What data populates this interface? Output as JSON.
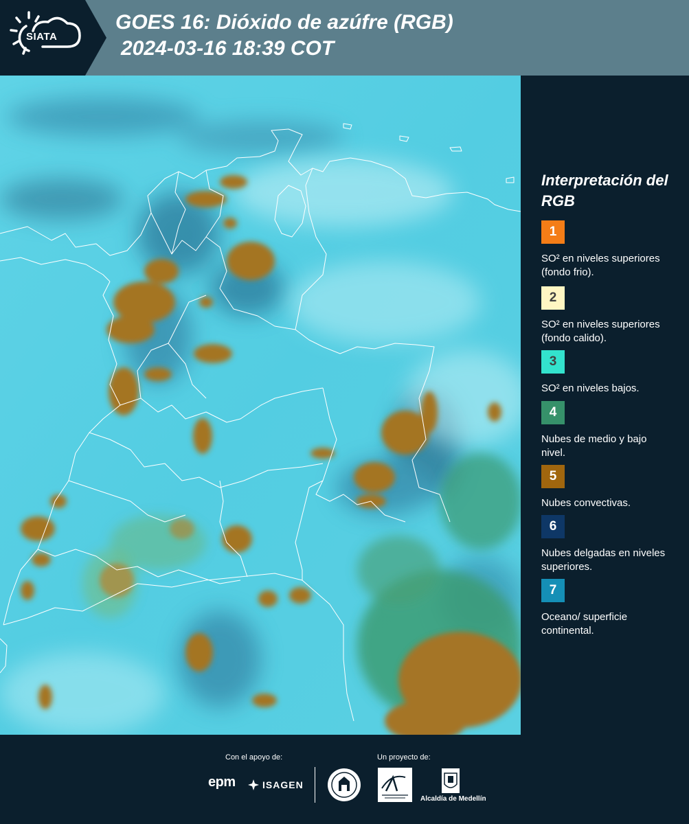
{
  "header": {
    "logo_text": "SIATA",
    "title": "GOES 16: Dióxido de azúfre (RGB)",
    "subtitle": "2024-03-16 18:39 COT"
  },
  "legend": {
    "title": "Interpretación del RGB",
    "items": [
      {
        "number": "1",
        "color": "#f47d17",
        "label": "SO² en niveles superiores (fondo frio)."
      },
      {
        "number": "2",
        "color": "#fff6c3",
        "label": "SO² en niveles superiores (fondo calido)."
      },
      {
        "number": "3",
        "color": "#33e2cd",
        "label": "SO² en niveles bajos."
      },
      {
        "number": "4",
        "color": "#36916a",
        "label": "Nubes de medio y bajo nivel."
      },
      {
        "number": "5",
        "color": "#a0660e",
        "label": "Nubes convectivas."
      },
      {
        "number": "6",
        "color": "#0e3766",
        "label": "Nubes delgadas en niveles superiores."
      },
      {
        "number": "7",
        "color": "#158fb6",
        "label": "Oceano/ superficie continental."
      }
    ]
  },
  "footer": {
    "support_label": "Con el apoyo de:",
    "project_label": "Un proyecto de:",
    "epm": "epm",
    "isagen": "ISAGEN",
    "alcaldia": "Alcaldía de Medellín"
  }
}
